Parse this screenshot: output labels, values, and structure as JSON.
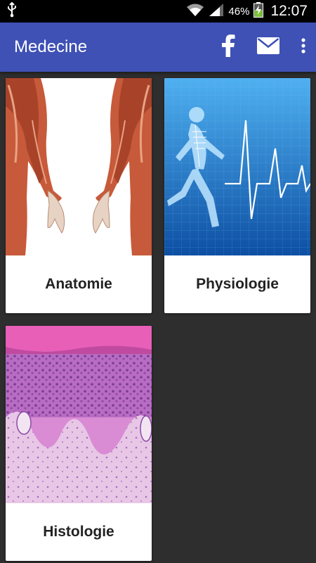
{
  "status_bar": {
    "battery_percent": "46%",
    "time": "12:07",
    "icons": [
      "usb-icon",
      "wifi-icon",
      "signal-icon",
      "battery-charging-icon"
    ]
  },
  "app_bar": {
    "title": "Medecine",
    "background_color": "#3f51b5",
    "actions": [
      "facebook-icon",
      "mail-icon",
      "overflow-menu-icon"
    ]
  },
  "cards": [
    {
      "label": "Anatomie",
      "image": "anatomy-muscles-image"
    },
    {
      "label": "Physiologie",
      "image": "physiology-runner-xray-image"
    },
    {
      "label": "Histologie",
      "image": "histology-tissue-image"
    }
  ],
  "colors": {
    "background": "#2e2e2e",
    "card": "#ffffff",
    "physiology_blue": "#1a73c9",
    "histology_pink": "#c465c4"
  }
}
